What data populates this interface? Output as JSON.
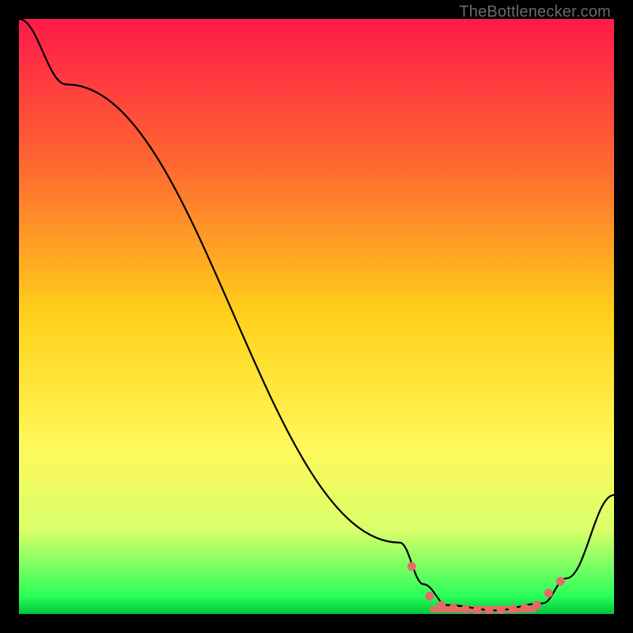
{
  "credit": "TheBottlenecker.com",
  "chart_data": {
    "type": "line",
    "title": "",
    "xlabel": "",
    "ylabel": "",
    "xlim": [
      0,
      100
    ],
    "ylim": [
      0,
      100
    ],
    "gradient_stops": [
      {
        "offset": 0,
        "color": "#ff1a4b"
      },
      {
        "offset": 25,
        "color": "#ff6a30"
      },
      {
        "offset": 50,
        "color": "#ffd21a"
      },
      {
        "offset": 72,
        "color": "#fff85a"
      },
      {
        "offset": 86,
        "color": "#d8ff6a"
      },
      {
        "offset": 97,
        "color": "#2aff5a"
      },
      {
        "offset": 100,
        "color": "#00c43a"
      }
    ],
    "series": [
      {
        "name": "bottleneck-curve",
        "stroke": "#000000",
        "stroke_width": 2.2,
        "points": [
          {
            "x": 0,
            "y": 100
          },
          {
            "x": 8,
            "y": 89
          },
          {
            "x": 64,
            "y": 12
          },
          {
            "x": 68,
            "y": 5
          },
          {
            "x": 72,
            "y": 1.5
          },
          {
            "x": 80,
            "y": 0.6
          },
          {
            "x": 88,
            "y": 1.8
          },
          {
            "x": 92,
            "y": 6
          },
          {
            "x": 100,
            "y": 20
          }
        ]
      }
    ],
    "markers": {
      "name": "highlight-dots",
      "fill": "#e66a6a",
      "radius": 5.5,
      "points": [
        {
          "x": 66,
          "y": 8
        },
        {
          "x": 69,
          "y": 3
        },
        {
          "x": 71,
          "y": 1.5
        },
        {
          "x": 73,
          "y": 1.0
        },
        {
          "x": 75,
          "y": 0.8
        },
        {
          "x": 77,
          "y": 0.6
        },
        {
          "x": 79,
          "y": 0.6
        },
        {
          "x": 81,
          "y": 0.6
        },
        {
          "x": 83,
          "y": 0.8
        },
        {
          "x": 85,
          "y": 1.0
        },
        {
          "x": 87,
          "y": 1.5
        },
        {
          "x": 89,
          "y": 3.5
        },
        {
          "x": 91,
          "y": 5.5
        }
      ]
    },
    "marker_bar": {
      "name": "highlight-bar",
      "fill": "#e66a6a",
      "x_start": 69,
      "x_end": 87,
      "y": 0.8,
      "thickness": 8
    }
  }
}
